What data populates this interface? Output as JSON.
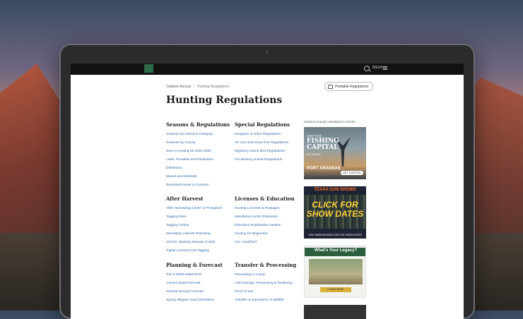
{
  "topbar": {
    "menu_label": "MENU"
  },
  "breadcrumb": {
    "parent": "Outdoor Annual",
    "separator": "|",
    "current": "Hunting Regulations"
  },
  "print_button": {
    "label": "Printable Regulations"
  },
  "page_title": "Hunting Regulations",
  "sections": {
    "seasons": {
      "heading": "Seasons & Regulations",
      "links": [
        "Seasons by Animal & Category",
        "Seasons by County",
        "New in Hunting for 2024-2025",
        "Laws, Penalties and Restitution",
        "Definitions",
        "Means and Methods",
        "Restricted Areas in Counties"
      ]
    },
    "special": {
      "heading": "Special Regulations",
      "links": [
        "Nongame & Other Regulations",
        "Air Gun and Arrow Gun Regulations",
        "Migratory Game Bird Regulations",
        "Fur-bearing Animal Regulations"
      ]
    },
    "after": {
      "heading": "After Harvest",
      "links": [
        "After Harvesting a Deer or Pronghorn",
        "Tagging Deer",
        "Tagging Turkey",
        "Mandatory Harvest Reporting",
        "Chronic Wasting Disease (CWD)",
        "Digital Licenses and Tagging"
      ]
    },
    "licenses": {
      "heading": "Licenses & Education",
      "links": [
        "Hunting Licenses & Packages",
        "Mandatory Hunter Education",
        "Education Registration System",
        "Hunting for Beginners",
        "Am I Certified?"
      ]
    },
    "planning": {
      "heading": "Planning & Forecast",
      "links": [
        "Rut in White-tailed Deer",
        "Current Quail Forecast",
        "Harvest Survey Forecast",
        "Spring Alligator Hunt Orientation"
      ]
    },
    "transfer": {
      "heading": "Transfer & Processing",
      "links": [
        "Processing in Camp",
        "Cold Storage, Processing & Taxidermy",
        "Proof of Sex",
        "Transfer & Importation of Wildlife"
      ]
    }
  },
  "ads": {
    "label": "Outdoor Annual Advertisers | Ad Info",
    "ad1": {
      "visit": "VISIT THE",
      "headline": "FISHING CAPITAL",
      "sub": "OF TEXAS",
      "place": "PORT ARANSAS",
      "button": "GET STARTED"
    },
    "ad2": {
      "header": "TEXAS GUN SHOWS",
      "cta": "CLICK FOR SHOW DATES",
      "footer": "VISIT AMERISHOWS.COM FOR SHOW DATES"
    },
    "ad3": {
      "header": "What's Your Legacy?",
      "sub": "A Future for Quail Starts Here",
      "button": "LEARN MORE"
    }
  }
}
